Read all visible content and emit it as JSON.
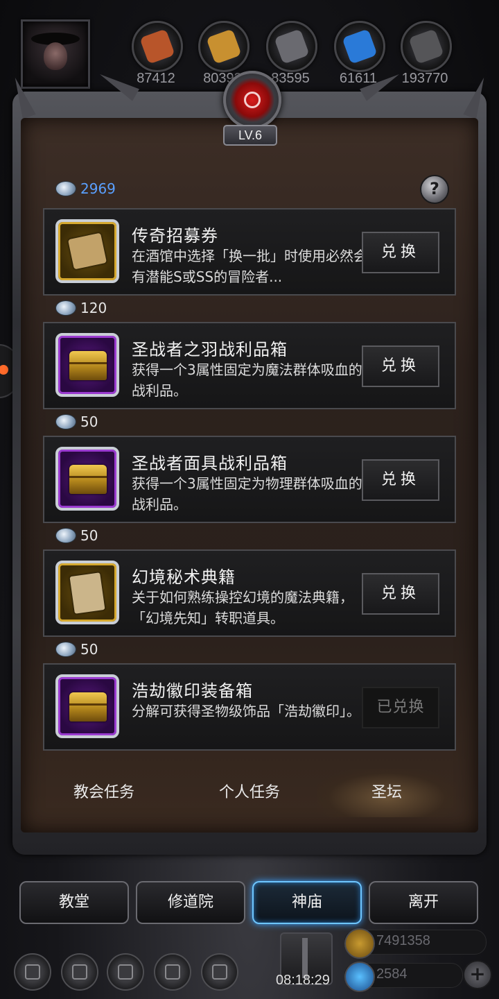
{
  "resources": [
    {
      "name": "leather-icon",
      "color": "#b8552a",
      "value": "87412"
    },
    {
      "name": "wood-icon",
      "color": "#c89030",
      "value": "80393"
    },
    {
      "name": "iron-icon",
      "color": "#6a6a70",
      "value": "83595"
    },
    {
      "name": "crystal-icon",
      "color": "#2a7ad8",
      "value": "61611"
    },
    {
      "name": "stone-icon",
      "color": "#555558",
      "value": "193770"
    }
  ],
  "level": "LV.6",
  "currency_total": "2969",
  "help_label": "?",
  "items": [
    {
      "title": "传奇招募券",
      "desc": "在酒馆中选择「换一批」时使用必然会有潜能S或SS的冒险者...",
      "button": "兑换",
      "icon": "scroll-icon",
      "frame": "gold",
      "price": "120"
    },
    {
      "title": "圣战者之羽战利品箱",
      "desc": "获得一个3属性固定为魔法群体吸血的战利品。",
      "button": "兑换",
      "icon": "chest-icon",
      "frame": "purple",
      "price": "50"
    },
    {
      "title": "圣战者面具战利品箱",
      "desc": "获得一个3属性固定为物理群体吸血的战利品。",
      "button": "兑换",
      "icon": "chest-icon",
      "frame": "purple",
      "price": "50"
    },
    {
      "title": "幻境秘术典籍",
      "desc": "关于如何熟练操控幻境的魔法典籍，「幻境先知」转职道具。",
      "button": "兑换",
      "icon": "book-icon",
      "frame": "gold",
      "price": "50"
    },
    {
      "title": "浩劫徽印装备箱",
      "desc": "分解可获得圣物级饰品「浩劫徽印」。",
      "button": "已兑换",
      "icon": "chest-icon",
      "frame": "purple"
    }
  ],
  "tabs": [
    {
      "label": "教会任务",
      "active": false
    },
    {
      "label": "个人任务",
      "active": false
    },
    {
      "label": "圣坛",
      "active": true
    }
  ],
  "nav": [
    {
      "label": "教堂",
      "active": false
    },
    {
      "label": "修道院",
      "active": false
    },
    {
      "label": "神庙",
      "active": true
    },
    {
      "label": "离开",
      "active": false
    }
  ],
  "timer": "08:18:29",
  "gold": "7491358",
  "gems": "2584",
  "colors": {
    "accent_blue": "#5aa0ff",
    "active_glow": "#3aa0ff",
    "emblem_red": "#d81c1c"
  }
}
